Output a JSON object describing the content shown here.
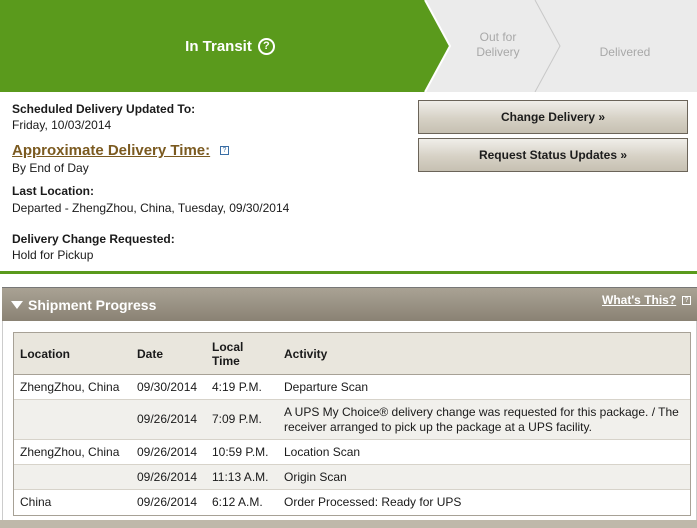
{
  "progress": {
    "steps": [
      {
        "label": "In Transit",
        "help": "?"
      },
      {
        "label_line1": "Out for",
        "label_line2": "Delivery"
      },
      {
        "label": "Delivered"
      }
    ]
  },
  "details": {
    "scheduled_label": "Scheduled Delivery Updated To:",
    "scheduled_value": "Friday, 10/03/2014",
    "approx_label": "Approximate Delivery Time:",
    "approx_value": "By End of Day",
    "last_location_label": "Last Location:",
    "last_location_value": "Departed - ZhengZhou, China, Tuesday, 09/30/2014",
    "change_requested_label": "Delivery Change Requested:",
    "change_requested_value": "Hold for Pickup"
  },
  "buttons": {
    "change_delivery": "Change Delivery »",
    "request_updates": "Request Status Updates »"
  },
  "shipment_progress": {
    "title": "Shipment Progress",
    "whats_this": "What's This?",
    "headers": [
      "Location",
      "Date",
      "Local Time",
      "Activity"
    ],
    "header_time_line1": "Local",
    "header_time_line2": "Time",
    "rows": [
      {
        "location": "ZhengZhou, China",
        "date": "09/30/2014",
        "time": "4:19 P.M.",
        "activity": "Departure Scan"
      },
      {
        "location": "",
        "date": "09/26/2014",
        "time": "7:09 P.M.",
        "activity": "A UPS My Choice® delivery change was requested for this package. / The receiver arranged to pick up the package at a UPS facility."
      },
      {
        "location": "ZhengZhou, China",
        "date": "09/26/2014",
        "time": "10:59 P.M.",
        "activity": "Location Scan"
      },
      {
        "location": "",
        "date": "09/26/2014",
        "time": "11:13 A.M.",
        "activity": "Origin Scan"
      },
      {
        "location": "China",
        "date": "09/26/2014",
        "time": "6:12 A.M.",
        "activity": "Order Processed: Ready for UPS"
      }
    ]
  },
  "colors": {
    "green": "#5a9a1c",
    "brown_link": "#7b5a20",
    "bar": "#8a8274"
  }
}
